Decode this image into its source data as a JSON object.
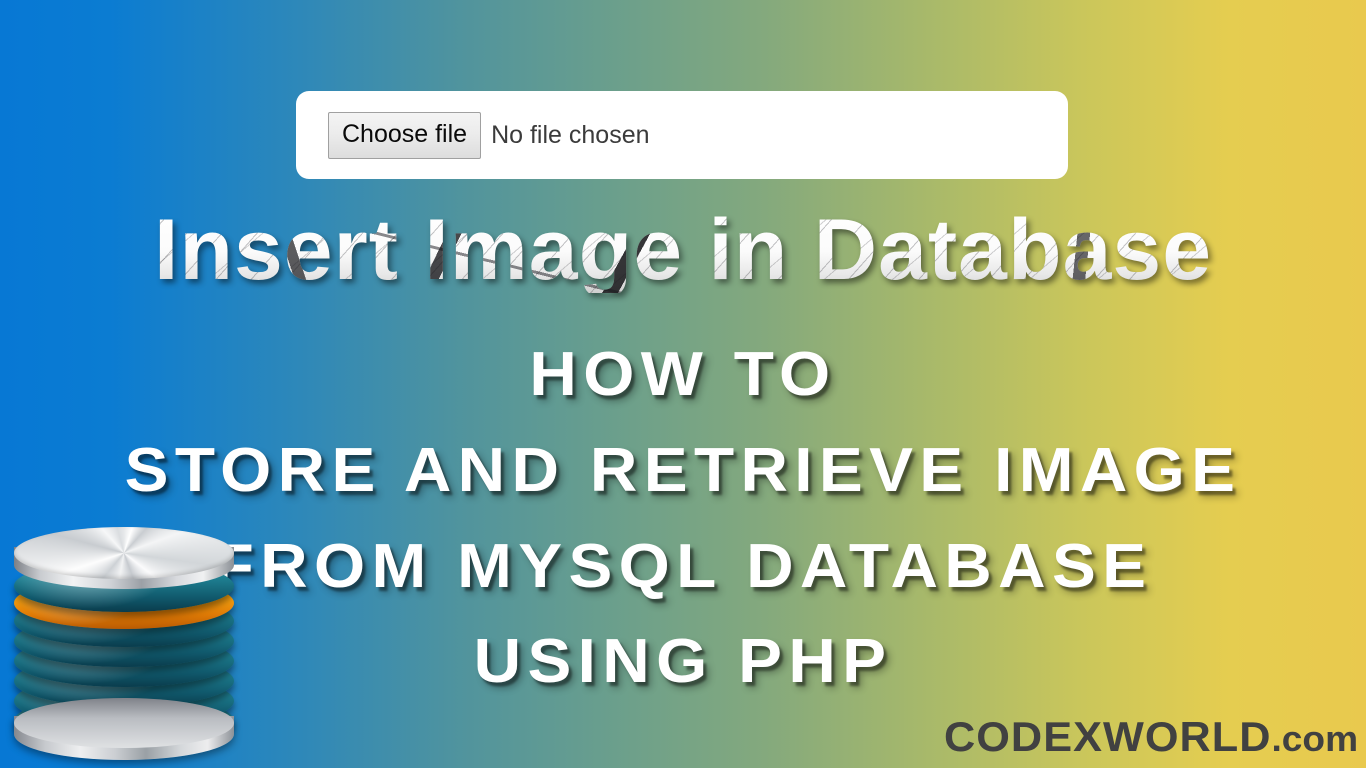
{
  "background": {
    "gradient_start": "#0778d4",
    "gradient_mid": "#6fa089",
    "gradient_end": "#e9c94e",
    "direction": "horizontal-left-to-right"
  },
  "file_input": {
    "button_label": "Choose file",
    "status_text": "No file chosen",
    "panel_color": "#ffffff"
  },
  "headline": {
    "text": "Insert Image in Database",
    "style": "marble-cracked-texture"
  },
  "subheadlines": [
    {
      "text": "HOW TO"
    },
    {
      "text": "STORE AND RETRIEVE IMAGE"
    },
    {
      "text": "FROM MYSQL DATABASE"
    },
    {
      "text": "USING PHP"
    }
  ],
  "database_icon": {
    "name": "database-stack-icon",
    "disc_color": "#1d7c8e",
    "highlight_disc_color": "#f9a812",
    "cap_color": "#d8dade",
    "disc_count": 9
  },
  "brand": {
    "name": "CODEXWORLD",
    "suffix": ".com",
    "color": "#414141"
  }
}
